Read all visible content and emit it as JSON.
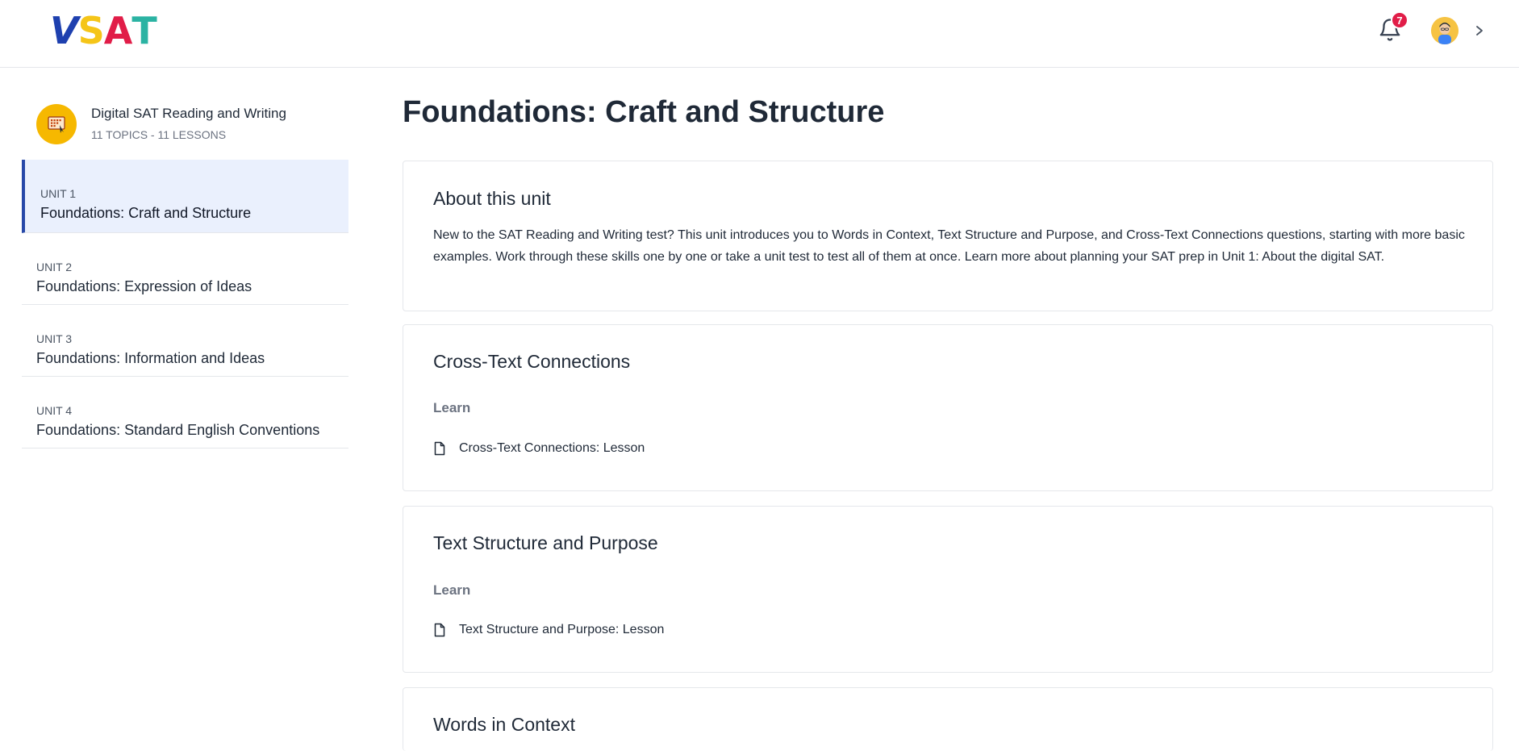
{
  "header": {
    "logo": {
      "letters": [
        "V",
        "S",
        "A",
        "T"
      ],
      "colors": [
        "#1e40af",
        "#f5c518",
        "#e11d48",
        "#2bb3a3"
      ]
    },
    "notifications": {
      "icon": "bell-icon",
      "count": "7"
    },
    "user": {
      "icon": "avatar"
    },
    "expand_icon": "chevron-right-icon"
  },
  "sidebar": {
    "course": {
      "icon": "classroom-board-icon",
      "title": "Digital SAT Reading and Writing",
      "subtitle": "11 TOPICS - 11 LESSONS"
    },
    "units": [
      {
        "label": "UNIT 1",
        "title": "Foundations: Craft and Structure",
        "active": true
      },
      {
        "label": "UNIT 2",
        "title": "Foundations: Expression of Ideas",
        "active": false
      },
      {
        "label": "UNIT 3",
        "title": "Foundations: Information and Ideas",
        "active": false
      },
      {
        "label": "UNIT 4",
        "title": "Foundations: Standard English Conventions",
        "active": false
      }
    ]
  },
  "main": {
    "title": "Foundations: Craft and Structure",
    "about": {
      "heading": "About this unit",
      "text": "New to the SAT Reading and Writing test? This unit introduces you to Words in Context, Text Structure and Purpose, and Cross-Text Connections questions, starting with more basic examples. Work through these skills one by one or take a unit test to test all of them at once. Learn more about planning your SAT prep in Unit 1: About the digital SAT."
    },
    "sections": [
      {
        "heading": "Cross-Text Connections",
        "group": "Learn",
        "lesson": "Cross-Text Connections: Lesson",
        "lesson_icon": "document-icon"
      },
      {
        "heading": "Text Structure and Purpose",
        "group": "Learn",
        "lesson": "Text Structure and Purpose: Lesson",
        "lesson_icon": "document-icon"
      },
      {
        "heading": "Words in Context"
      }
    ]
  },
  "colors": {
    "accent": "#2748a8",
    "active_bg": "#eaf0fd",
    "badge": "#e11d48",
    "course_icon_bg": "#f6b800"
  }
}
